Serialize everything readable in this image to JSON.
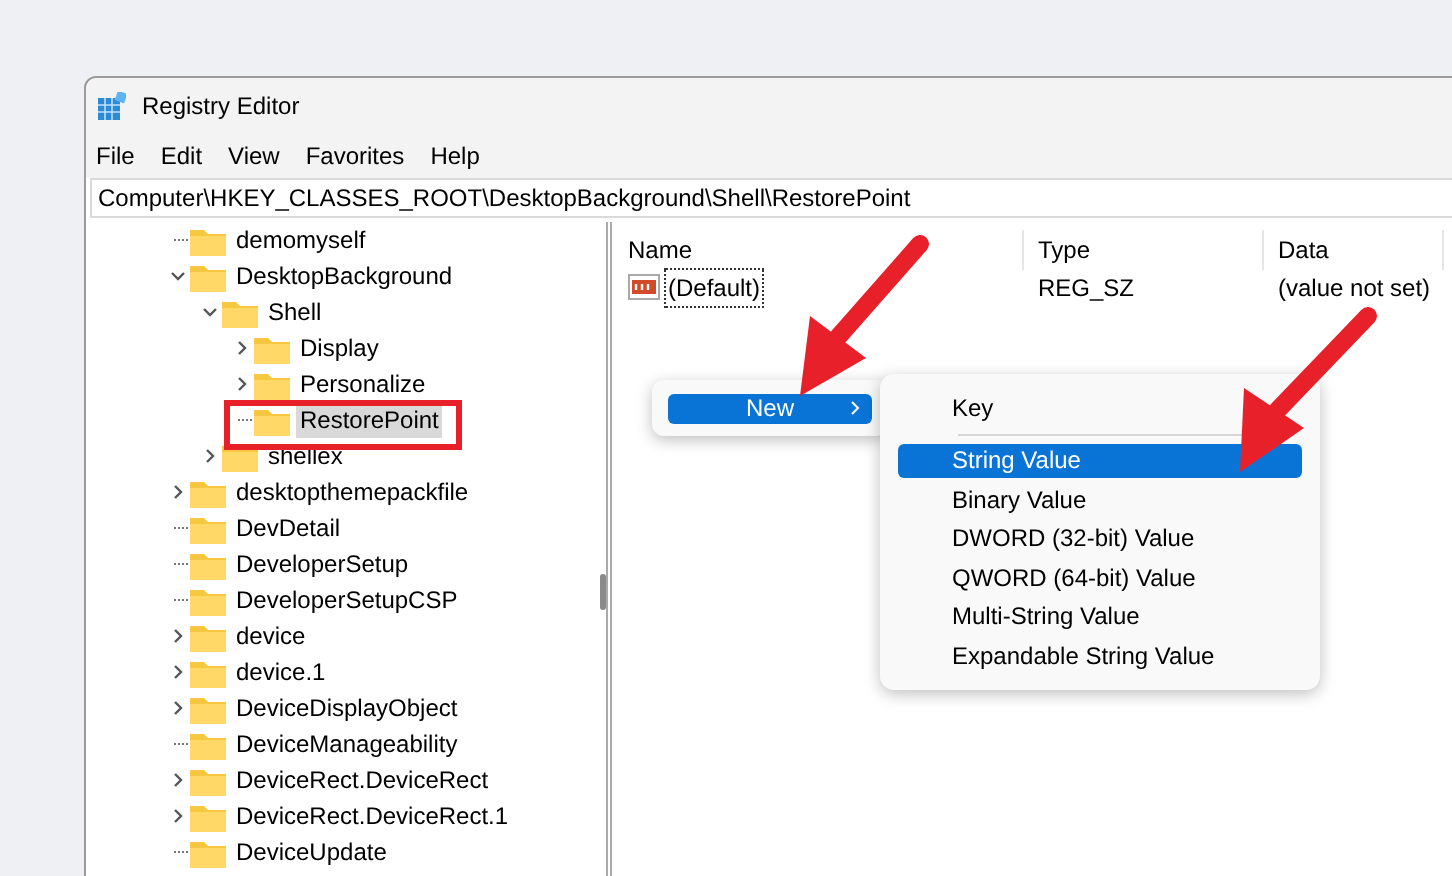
{
  "window": {
    "title": "Registry Editor"
  },
  "menu": [
    "File",
    "Edit",
    "View",
    "Favorites",
    "Help"
  ],
  "address": "Computer\\HKEY_CLASSES_ROOT\\DesktopBackground\\Shell\\RestorePoint",
  "tree": [
    {
      "label": "demomyself",
      "expandable": false,
      "selected": false
    },
    {
      "label": "DesktopBackground",
      "expandable": true,
      "expanded": true,
      "selected": false,
      "children": [
        {
          "label": "Shell",
          "expandable": true,
          "expanded": true,
          "selected": false,
          "children": [
            {
              "label": "Display",
              "expandable": true,
              "expanded": false,
              "selected": false
            },
            {
              "label": "Personalize",
              "expandable": true,
              "expanded": false,
              "selected": false
            },
            {
              "label": "RestorePoint",
              "expandable": false,
              "selected": true
            }
          ]
        },
        {
          "label": "shellex",
          "expandable": true,
          "expanded": false,
          "selected": false
        }
      ]
    },
    {
      "label": "desktopthemepackfile",
      "expandable": true,
      "expanded": false,
      "selected": false
    },
    {
      "label": "DevDetail",
      "expandable": false,
      "selected": false
    },
    {
      "label": "DeveloperSetup",
      "expandable": false,
      "selected": false
    },
    {
      "label": "DeveloperSetupCSP",
      "expandable": false,
      "selected": false
    },
    {
      "label": "device",
      "expandable": true,
      "expanded": false,
      "selected": false
    },
    {
      "label": "device.1",
      "expandable": true,
      "expanded": false,
      "selected": false
    },
    {
      "label": "DeviceDisplayObject",
      "expandable": true,
      "expanded": false,
      "selected": false
    },
    {
      "label": "DeviceManageability",
      "expandable": false,
      "selected": false
    },
    {
      "label": "DeviceRect.DeviceRect",
      "expandable": true,
      "expanded": false,
      "selected": false
    },
    {
      "label": "DeviceRect.DeviceRect.1",
      "expandable": true,
      "expanded": false,
      "selected": false
    },
    {
      "label": "DeviceUpdate",
      "expandable": false,
      "selected": false
    }
  ],
  "table": {
    "columns": [
      "Name",
      "Type",
      "Data"
    ],
    "rows": [
      [
        "(Default)",
        "REG_SZ",
        "(value not set)"
      ]
    ]
  },
  "context_menu": [
    {
      "label": "New",
      "selected": true,
      "submenu": true
    }
  ],
  "submenu": [
    {
      "kind": "item",
      "label": "Key",
      "selected": false
    },
    {
      "kind": "separator"
    },
    {
      "kind": "item",
      "label": "String Value",
      "selected": true
    },
    {
      "kind": "item",
      "label": "Binary Value",
      "selected": false
    },
    {
      "kind": "item",
      "label": "DWORD (32-bit) Value",
      "selected": false
    },
    {
      "kind": "item",
      "label": "QWORD (64-bit) Value",
      "selected": false
    },
    {
      "kind": "item",
      "label": "Multi-String Value",
      "selected": false
    },
    {
      "kind": "item",
      "label": "Expandable String Value",
      "selected": false
    }
  ]
}
